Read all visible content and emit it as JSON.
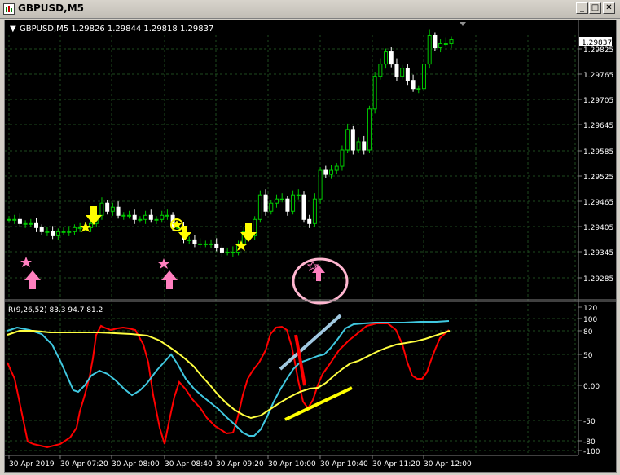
{
  "window": {
    "title": "GBPUSD,M5",
    "minimize_glyph": "_",
    "maximize_glyph": "□",
    "close_glyph": "✕"
  },
  "price_panel": {
    "header_arrow": "▼",
    "header": "GBPUSD,M5  1.29826 1.29844 1.29818 1.29837",
    "current_price": "1.29837",
    "price_labels": [
      "1.29825",
      "1.29765",
      "1.29705",
      "1.29645",
      "1.29585",
      "1.29525",
      "1.29465",
      "1.29405",
      "1.29345",
      "1.29285"
    ]
  },
  "indicator_panel": {
    "header": "R(9,26,52) 83.3 94.7 81.2",
    "level_labels": [
      "120",
      "100",
      "80",
      "50",
      "0.00",
      "-50",
      "-80",
      "-100"
    ]
  },
  "time_labels": [
    "30 Apr 2019",
    "30 Apr 07:20",
    "30 Apr 08:00",
    "30 Apr 08:40",
    "30 Apr 09:20",
    "30 Apr 10:00",
    "30 Apr 10:40",
    "30 Apr 11:20",
    "30 Apr 12:00"
  ],
  "colors": {
    "bull_candle": "#00c800",
    "bear_candle": "#ffffff",
    "grid": "#1e4a1e",
    "text": "#ffffff",
    "buy_arrow": "#ff7fbf",
    "sell_arrow": "#ffff00",
    "red_line": "#ff0000",
    "cyan_line": "#40c8e0",
    "yellow_line": "#ffff40"
  },
  "chart_data": {
    "type": "candlestick",
    "symbol": "GBPUSD",
    "timeframe": "M5",
    "price_range": [
      1.29285,
      1.29845
    ],
    "current": 1.29837,
    "ohlc_last": {
      "open": 1.29826,
      "high": 1.29844,
      "low": 1.29818,
      "close": 1.29837
    },
    "close_series": [
      1.294,
      1.294,
      1.2939,
      1.2939,
      1.2939,
      1.2938,
      1.2937,
      1.2937,
      1.2936,
      1.2937,
      1.2937,
      1.2937,
      1.2938,
      1.2938,
      1.2938,
      1.2939,
      1.2941,
      1.2944,
      1.2942,
      1.2943,
      1.2941,
      1.2941,
      1.2941,
      1.294,
      1.294,
      1.2941,
      1.294,
      1.294,
      1.2941,
      1.2941,
      1.2938,
      1.2938,
      1.2935,
      1.2935,
      1.2934,
      1.2934,
      1.2934,
      1.2934,
      1.2933,
      1.2932,
      1.2932,
      1.2932,
      1.2934,
      1.2937,
      1.2936,
      1.294,
      1.2946,
      1.2942,
      1.2944,
      1.2945,
      1.2945,
      1.2942,
      1.2946,
      1.2946,
      1.294,
      1.2939,
      1.2945,
      1.2952,
      1.2951,
      1.2952,
      1.2953,
      1.2957,
      1.2962,
      1.2957,
      1.2959,
      1.2957,
      1.2967,
      1.2975,
      1.2978,
      1.2981,
      1.2978,
      1.2975,
      1.2977,
      1.2974,
      1.2972,
      1.2972,
      1.2978,
      1.2985,
      1.2982,
      1.2983,
      1.2983,
      1.2984
    ],
    "indicator": {
      "name": "R(9,26,52)",
      "values": [
        83.3,
        94.7,
        81.2
      ],
      "levels": [
        100,
        80,
        50,
        0,
        -50,
        -80,
        -100
      ]
    },
    "x_ticks": [
      "30 Apr 2019",
      "30 Apr 07:20",
      "30 Apr 08:00",
      "30 Apr 08:40",
      "30 Apr 09:20",
      "30 Apr 10:00",
      "30 Apr 10:40",
      "30 Apr 11:20",
      "30 Apr 12:00"
    ]
  }
}
